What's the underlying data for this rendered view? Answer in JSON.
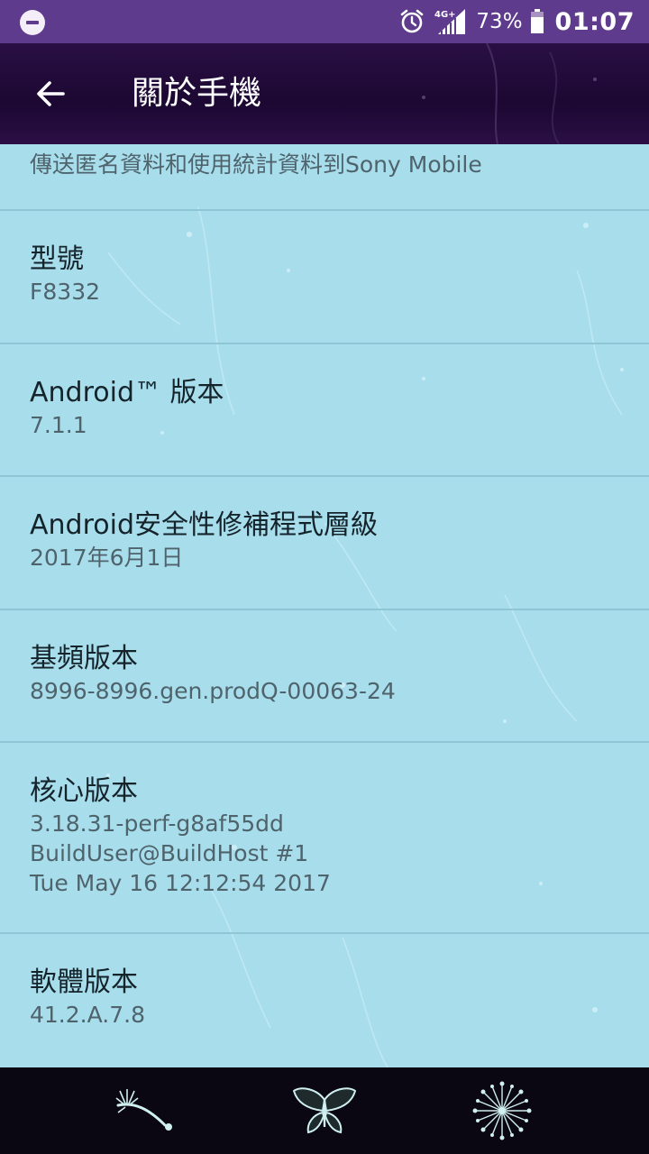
{
  "status_bar": {
    "network_type": "4G+",
    "battery_percent": "73%",
    "time": "01:07",
    "icons": [
      "do-not-disturb-icon",
      "alarm-icon",
      "signal-icon",
      "battery-icon"
    ]
  },
  "toolbar": {
    "title": "關於手機",
    "back_icon": "arrow-back-icon"
  },
  "rows": [
    {
      "summary": "傳送匿名資料和使用統計資料到Sony Mobile"
    },
    {
      "title": "型號",
      "summary": "F8332"
    },
    {
      "title": "Android™ 版本",
      "summary": "7.1.1"
    },
    {
      "title": "Android安全性修補程式層級",
      "summary": "2017年6月1日"
    },
    {
      "title": "基頻版本",
      "summary": "8996-8996.gen.prodQ-00063-24"
    },
    {
      "title": "核心版本",
      "summary": "3.18.31-perf-g8af55dd\nBuildUser@BuildHost #1\nTue May 16 12:12:54 2017"
    },
    {
      "title": "軟體版本",
      "summary": "41.2.A.7.8"
    }
  ],
  "bottom_nav": {
    "buttons": [
      "dandelion-back-icon",
      "butterfly-home-icon",
      "dandelion-recents-icon"
    ]
  },
  "colors": {
    "status_bar": "#5e3b8c",
    "toolbar": "#1c0832",
    "content_bg": "#a8deec",
    "nav_bar": "#0a0612"
  }
}
